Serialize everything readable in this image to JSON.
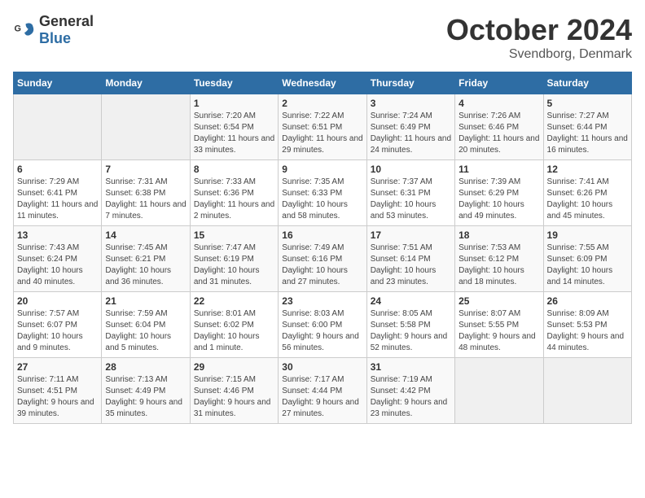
{
  "header": {
    "logo_general": "General",
    "logo_blue": "Blue",
    "title": "October 2024",
    "location": "Svendborg, Denmark"
  },
  "weekdays": [
    "Sunday",
    "Monday",
    "Tuesday",
    "Wednesday",
    "Thursday",
    "Friday",
    "Saturday"
  ],
  "weeks": [
    [
      {
        "day": "",
        "empty": true
      },
      {
        "day": "",
        "empty": true
      },
      {
        "day": "1",
        "sunrise": "7:20 AM",
        "sunset": "6:54 PM",
        "daylight": "11 hours and 33 minutes."
      },
      {
        "day": "2",
        "sunrise": "7:22 AM",
        "sunset": "6:51 PM",
        "daylight": "11 hours and 29 minutes."
      },
      {
        "day": "3",
        "sunrise": "7:24 AM",
        "sunset": "6:49 PM",
        "daylight": "11 hours and 24 minutes."
      },
      {
        "day": "4",
        "sunrise": "7:26 AM",
        "sunset": "6:46 PM",
        "daylight": "11 hours and 20 minutes."
      },
      {
        "day": "5",
        "sunrise": "7:27 AM",
        "sunset": "6:44 PM",
        "daylight": "11 hours and 16 minutes."
      }
    ],
    [
      {
        "day": "6",
        "sunrise": "7:29 AM",
        "sunset": "6:41 PM",
        "daylight": "11 hours and 11 minutes."
      },
      {
        "day": "7",
        "sunrise": "7:31 AM",
        "sunset": "6:38 PM",
        "daylight": "11 hours and 7 minutes."
      },
      {
        "day": "8",
        "sunrise": "7:33 AM",
        "sunset": "6:36 PM",
        "daylight": "11 hours and 2 minutes."
      },
      {
        "day": "9",
        "sunrise": "7:35 AM",
        "sunset": "6:33 PM",
        "daylight": "10 hours and 58 minutes."
      },
      {
        "day": "10",
        "sunrise": "7:37 AM",
        "sunset": "6:31 PM",
        "daylight": "10 hours and 53 minutes."
      },
      {
        "day": "11",
        "sunrise": "7:39 AM",
        "sunset": "6:29 PM",
        "daylight": "10 hours and 49 minutes."
      },
      {
        "day": "12",
        "sunrise": "7:41 AM",
        "sunset": "6:26 PM",
        "daylight": "10 hours and 45 minutes."
      }
    ],
    [
      {
        "day": "13",
        "sunrise": "7:43 AM",
        "sunset": "6:24 PM",
        "daylight": "10 hours and 40 minutes."
      },
      {
        "day": "14",
        "sunrise": "7:45 AM",
        "sunset": "6:21 PM",
        "daylight": "10 hours and 36 minutes."
      },
      {
        "day": "15",
        "sunrise": "7:47 AM",
        "sunset": "6:19 PM",
        "daylight": "10 hours and 31 minutes."
      },
      {
        "day": "16",
        "sunrise": "7:49 AM",
        "sunset": "6:16 PM",
        "daylight": "10 hours and 27 minutes."
      },
      {
        "day": "17",
        "sunrise": "7:51 AM",
        "sunset": "6:14 PM",
        "daylight": "10 hours and 23 minutes."
      },
      {
        "day": "18",
        "sunrise": "7:53 AM",
        "sunset": "6:12 PM",
        "daylight": "10 hours and 18 minutes."
      },
      {
        "day": "19",
        "sunrise": "7:55 AM",
        "sunset": "6:09 PM",
        "daylight": "10 hours and 14 minutes."
      }
    ],
    [
      {
        "day": "20",
        "sunrise": "7:57 AM",
        "sunset": "6:07 PM",
        "daylight": "10 hours and 9 minutes."
      },
      {
        "day": "21",
        "sunrise": "7:59 AM",
        "sunset": "6:04 PM",
        "daylight": "10 hours and 5 minutes."
      },
      {
        "day": "22",
        "sunrise": "8:01 AM",
        "sunset": "6:02 PM",
        "daylight": "10 hours and 1 minute."
      },
      {
        "day": "23",
        "sunrise": "8:03 AM",
        "sunset": "6:00 PM",
        "daylight": "9 hours and 56 minutes."
      },
      {
        "day": "24",
        "sunrise": "8:05 AM",
        "sunset": "5:58 PM",
        "daylight": "9 hours and 52 minutes."
      },
      {
        "day": "25",
        "sunrise": "8:07 AM",
        "sunset": "5:55 PM",
        "daylight": "9 hours and 48 minutes."
      },
      {
        "day": "26",
        "sunrise": "8:09 AM",
        "sunset": "5:53 PM",
        "daylight": "9 hours and 44 minutes."
      }
    ],
    [
      {
        "day": "27",
        "sunrise": "7:11 AM",
        "sunset": "4:51 PM",
        "daylight": "9 hours and 39 minutes."
      },
      {
        "day": "28",
        "sunrise": "7:13 AM",
        "sunset": "4:49 PM",
        "daylight": "9 hours and 35 minutes."
      },
      {
        "day": "29",
        "sunrise": "7:15 AM",
        "sunset": "4:46 PM",
        "daylight": "9 hours and 31 minutes."
      },
      {
        "day": "30",
        "sunrise": "7:17 AM",
        "sunset": "4:44 PM",
        "daylight": "9 hours and 27 minutes."
      },
      {
        "day": "31",
        "sunrise": "7:19 AM",
        "sunset": "4:42 PM",
        "daylight": "9 hours and 23 minutes."
      },
      {
        "day": "",
        "empty": true
      },
      {
        "day": "",
        "empty": true
      }
    ]
  ]
}
